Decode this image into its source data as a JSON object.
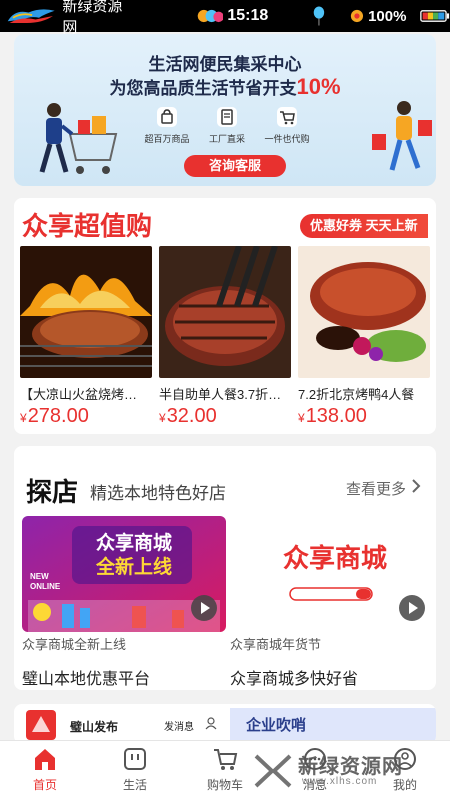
{
  "status": {
    "site_name": "新绿资源网",
    "time": "15:18",
    "battery": "100%"
  },
  "banner": {
    "line1": "生活网便民集采中心",
    "line2_text": "为您高品质生活节省开支",
    "line2_pct": "10%",
    "features": [
      {
        "icon": "shopping-bag-icon",
        "label": "超百万商品"
      },
      {
        "icon": "document-icon",
        "label": "工厂直采"
      },
      {
        "icon": "cart-icon",
        "label": "一件也代购"
      }
    ],
    "consult_label": "咨询客服"
  },
  "deals": {
    "title": "众享超值购",
    "tag": "优惠好券 天天上新",
    "items": [
      {
        "name": "【大凉山火盆烧烤…",
        "currency": "¥",
        "price": "278.00"
      },
      {
        "name": "半自助单人餐3.7折…",
        "currency": "¥",
        "price": "32.00"
      },
      {
        "name": "7.2折北京烤鸭4人餐",
        "currency": "¥",
        "price": "138.00"
      }
    ]
  },
  "explore": {
    "title": "探店",
    "subtitle": "精选本地特色好店",
    "more": "查看更多",
    "items": [
      {
        "caption": "众享商城全新上线",
        "title": "璧山本地优惠平台",
        "poster_line1": "众享商城",
        "poster_line2": "全新上线",
        "poster_small": "NEW ONLINE"
      },
      {
        "caption": "众享商城年货节",
        "title": "众享商城多快好省",
        "poster_line1": "众享商城"
      }
    ]
  },
  "peek": {
    "publish": "璧山发布",
    "send_msg": "发消息",
    "ad_text": "企业吹哨"
  },
  "tabs": [
    {
      "label": "首页",
      "icon": "home-icon",
      "active": true
    },
    {
      "label": "生活",
      "icon": "life-icon",
      "active": false
    },
    {
      "label": "购物车",
      "icon": "cart-icon",
      "active": false
    },
    {
      "label": "消息",
      "icon": "message-icon",
      "active": false
    },
    {
      "label": "我的",
      "icon": "profile-icon",
      "active": false
    }
  ],
  "watermark": {
    "text": "新绿资源网",
    "url": "www.xlhs.com"
  },
  "colors": {
    "accent": "#e8312f",
    "banner_bg": "#d9ecf8",
    "page_bg": "#f2f2f2"
  }
}
